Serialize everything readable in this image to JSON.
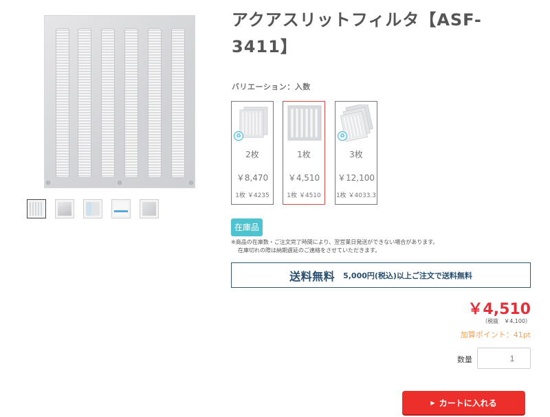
{
  "product": {
    "title": "アクアスリットフィルタ【ASF-3411】",
    "thumbnails": [
      "thumb-1",
      "thumb-2",
      "thumb-3",
      "thumb-4",
      "thumb-5"
    ]
  },
  "variation": {
    "label": "バリエーション：入数",
    "options": [
      {
        "count": "2枚",
        "price": "￥8,470",
        "unit_price": "1枚 ￥4235",
        "selected": false
      },
      {
        "count": "1枚",
        "price": "￥4,510",
        "unit_price": "1枚 ￥4510",
        "selected": true
      },
      {
        "count": "3枚",
        "price": "￥12,100",
        "unit_price": "1枚 ￥4033.3",
        "selected": false
      }
    ]
  },
  "stock": {
    "badge": "在庫品",
    "note_line1": "※商品の在庫数・ご注文完了時間により、翌営業日発送ができない場合があります。",
    "note_line2": "在庫切れの際は納期遅延のご連絡をさせていただきます。"
  },
  "shipping": {
    "headline": "送料無料",
    "detail": "5,000円(税込)以上ご注文で送料無料"
  },
  "pricing": {
    "price": "￥4,510",
    "tax_note": "（税抜　￥4,100）",
    "points": "加算ポイント：41pt"
  },
  "quantity": {
    "label": "数量",
    "value": "1"
  },
  "cart": {
    "button_label": "カートに入れる",
    "arrow": "▶"
  },
  "colors": {
    "accent_red": "#ec2f2b",
    "price_red": "#e0313a",
    "stock_teal": "#4fc3cf",
    "shipping_navy": "#274e6e",
    "points_orange": "#f0a25a"
  }
}
